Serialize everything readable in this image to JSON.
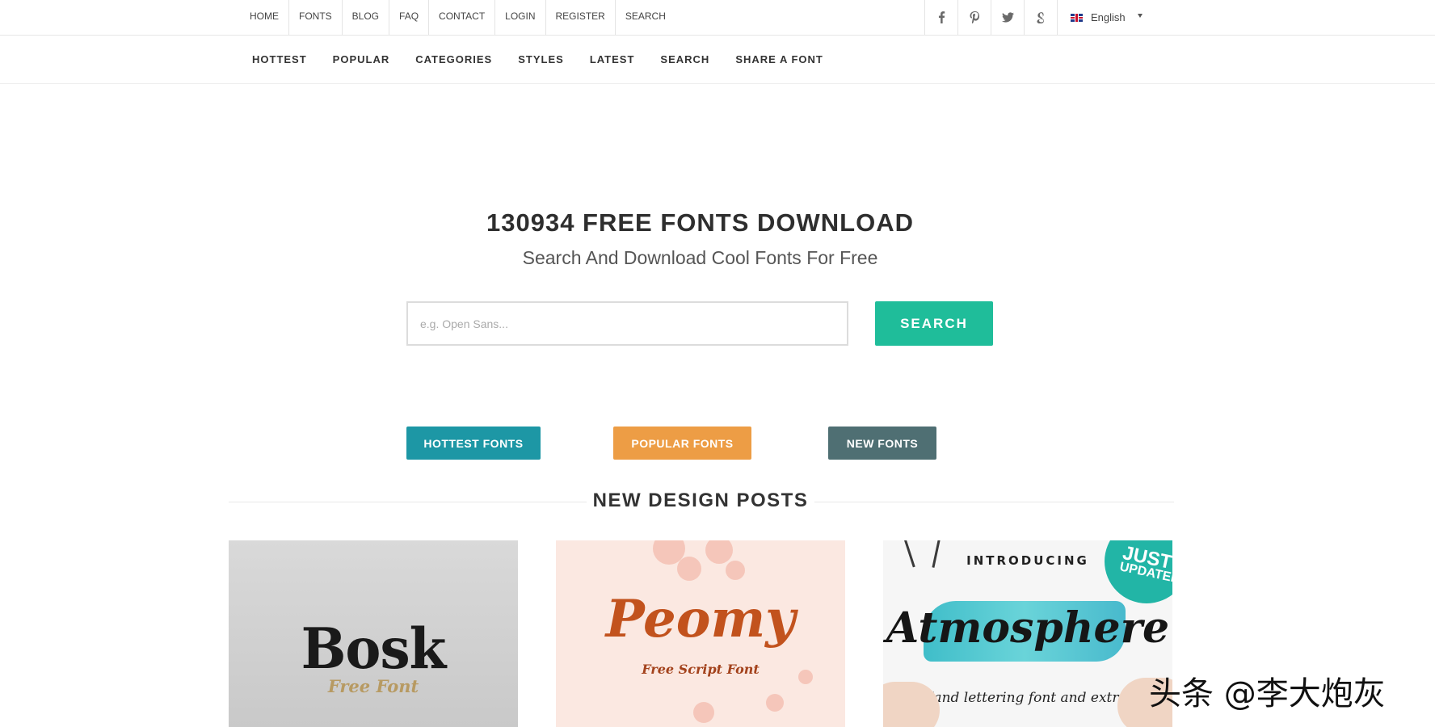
{
  "top_nav": [
    "HOME",
    "FONTS",
    "BLOG",
    "FAQ",
    "CONTACT",
    "LOGIN",
    "REGISTER",
    "SEARCH"
  ],
  "social_icons": [
    "facebook-icon",
    "pinterest-icon",
    "twitter-icon",
    "google-plus-icon"
  ],
  "language": "English",
  "main_nav": [
    "HOTTEST",
    "POPULAR",
    "CATEGORIES",
    "STYLES",
    "LATEST",
    "SEARCH",
    "SHARE A FONT"
  ],
  "hero": {
    "title": "130934 FREE FONTS DOWNLOAD",
    "subtitle": "Search And Download Cool Fonts For Free",
    "search_placeholder": "e.g. Open Sans...",
    "search_button": "SEARCH"
  },
  "buttons": {
    "hottest": "HOTTEST FONTS",
    "popular": "POPULAR FONTS",
    "new": "NEW FONTS"
  },
  "section_title": "NEW DESIGN POSTS",
  "posts": [
    {
      "title": "Bosk",
      "subtitle": "Free Font"
    },
    {
      "title": "Peomy",
      "subtitle": "Free Script Font"
    },
    {
      "intro": "INTRODUCING",
      "title": "Atmosphere",
      "subtitle": "Hand lettering font and extras",
      "badge_line1": "JUST",
      "badge_line2": "UPDATED"
    }
  ],
  "watermark": "头条 @李大炮灰",
  "colors": {
    "search_button": "#1fbd9a",
    "hottest": "#1d97a5",
    "popular": "#ed9d45",
    "new": "#4f6f73"
  }
}
